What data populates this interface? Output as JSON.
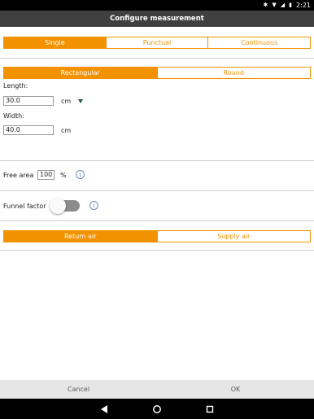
{
  "status_bar": {
    "time": "2:21",
    "icons": [
      "bluetooth-icon",
      "wifi-icon",
      "signal-icon",
      "battery-icon"
    ]
  },
  "app_bar": {
    "title": "Configure measurement"
  },
  "mode_tabs": [
    "Single",
    "Punctual",
    "Continuous"
  ],
  "mode_selected": "Single",
  "shape_tabs": [
    "Rectangular",
    "Round"
  ],
  "shape_selected": "Rectangular",
  "length": {
    "label": "Length:",
    "value": "30.0",
    "unit": "cm"
  },
  "width": {
    "label": "Width:",
    "value": "40.0",
    "unit": "cm"
  },
  "free_area": {
    "label": "Free area",
    "value": "100",
    "unit": "%"
  },
  "funnel_factor": {
    "label": "Funnel factor",
    "enabled": false
  },
  "air_tabs": [
    "Return air",
    "Supply air"
  ],
  "air_selected": "Return air",
  "footer": {
    "cancel": "Cancel",
    "ok": "OK"
  },
  "colors": {
    "accent": "#f39200",
    "app_bar": "#404040",
    "info": "#6d8fc0"
  }
}
